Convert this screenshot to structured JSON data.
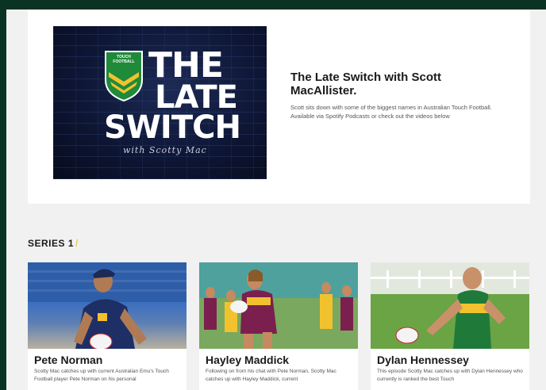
{
  "hero": {
    "logo_badge": "TOUCH FOOTBALL",
    "logo_line1": "THE",
    "logo_line2": "LATE",
    "logo_line3": "SWITCH",
    "logo_script": "with Scotty Mac",
    "title": "The Late Switch with Scott MacAllister.",
    "description": "Scott sits down with some of the biggest names in Australian Touch Football. Available via Spotify Podcasts or check out the videos below"
  },
  "series": {
    "heading": "SERIES 1",
    "slash": "/"
  },
  "episodes": [
    {
      "name": "Pete Norman",
      "description": "Scotty Mac catches up with current Australian Emu's Touch Football player Pete Norman on his personal"
    },
    {
      "name": "Hayley Maddick",
      "description": "Following on from his chat with Pete Norman, Scotty Mac catches up with Hayley Maddick, current"
    },
    {
      "name": "Dylan Hennessey",
      "description": "This episode Scotty Mac catches up with Dylan Hennessey who currently is ranked the best Touch"
    }
  ],
  "colors": {
    "page_border": "#0b3324",
    "content_bg": "#f1f1f1",
    "card_bg": "#ffffff",
    "accent_slash": "#f2c94c",
    "shield_green": "#1f8a3a",
    "shield_gold": "#f2c22e"
  }
}
